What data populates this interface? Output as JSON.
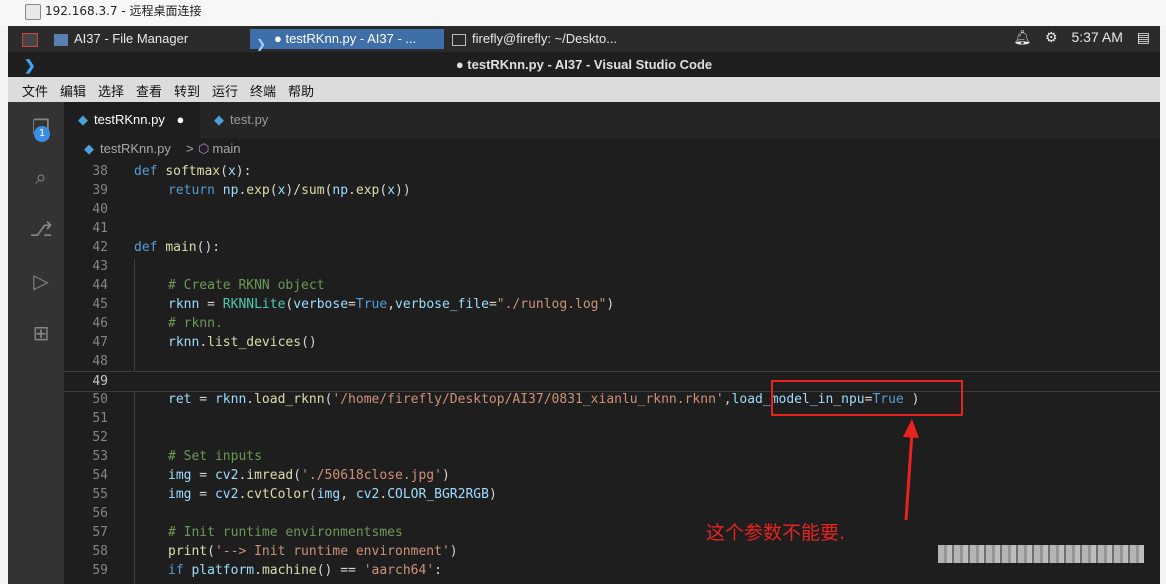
{
  "rdp": {
    "title": "192.168.3.7 - 远程桌面连接"
  },
  "taskbar": {
    "apps": [
      {
        "label": "AI37 - File Manager"
      },
      {
        "label": "● testRKnn.py - AI37 - ..."
      },
      {
        "label": "firefly@firefly: ~/Deskto..."
      }
    ],
    "time": "5:37 AM",
    "tray_icons": [
      "bell-icon",
      "gear-icon",
      "clipboard-icon"
    ]
  },
  "window": {
    "title": "● testRKnn.py - AI37 - Visual Studio Code"
  },
  "menu": [
    "文件",
    "编辑",
    "选择",
    "查看",
    "转到",
    "运行",
    "终端",
    "帮助"
  ],
  "activity": {
    "badge": "1",
    "icons": [
      "explorer-icon",
      "search-icon",
      "source-control-icon",
      "run-debug-icon",
      "extensions-icon"
    ]
  },
  "tabs": [
    {
      "label": "testRKnn.py",
      "modified": "●"
    },
    {
      "label": "test.py"
    }
  ],
  "breadcrumb": {
    "file": "testRKnn.py",
    "sep": ">",
    "symbol": "main"
  },
  "lines": [
    {
      "n": "38",
      "indent": 0,
      "tokens": [
        [
          "kw",
          "def "
        ],
        [
          "fn",
          "softmax"
        ],
        [
          "pn",
          "("
        ],
        [
          "var",
          "x"
        ],
        [
          "pn",
          "):"
        ]
      ]
    },
    {
      "n": "39",
      "indent": 1,
      "tokens": [
        [
          "kw",
          "return "
        ],
        [
          "var",
          "np"
        ],
        [
          "pn",
          "."
        ],
        [
          "fn",
          "exp"
        ],
        [
          "pn",
          "("
        ],
        [
          "var",
          "x"
        ],
        [
          "pn",
          ")/"
        ],
        [
          "fn",
          "sum"
        ],
        [
          "pn",
          "("
        ],
        [
          "var",
          "np"
        ],
        [
          "pn",
          "."
        ],
        [
          "fn",
          "exp"
        ],
        [
          "pn",
          "("
        ],
        [
          "var",
          "x"
        ],
        [
          "pn",
          "))"
        ]
      ]
    },
    {
      "n": "40",
      "indent": 0,
      "tokens": []
    },
    {
      "n": "41",
      "indent": 0,
      "tokens": []
    },
    {
      "n": "42",
      "indent": 0,
      "tokens": [
        [
          "kw",
          "def "
        ],
        [
          "fn",
          "main"
        ],
        [
          "pn",
          "():"
        ]
      ]
    },
    {
      "n": "43",
      "indent": 0,
      "tokens": []
    },
    {
      "n": "44",
      "indent": 1,
      "tokens": [
        [
          "cm",
          "# Create RKNN object"
        ]
      ]
    },
    {
      "n": "45",
      "indent": 1,
      "tokens": [
        [
          "var",
          "rknn"
        ],
        [
          "pn",
          " = "
        ],
        [
          "cls",
          "RKNNLite"
        ],
        [
          "pn",
          "("
        ],
        [
          "var",
          "verbose"
        ],
        [
          "pn",
          "="
        ],
        [
          "kw",
          "True"
        ],
        [
          "pn",
          ","
        ],
        [
          "var",
          "verbose_file"
        ],
        [
          "pn",
          "="
        ],
        [
          "str",
          "\"./runlog.log\""
        ],
        [
          "pn",
          ")"
        ]
      ]
    },
    {
      "n": "46",
      "indent": 1,
      "tokens": [
        [
          "cm",
          "# rknn."
        ]
      ]
    },
    {
      "n": "47",
      "indent": 1,
      "tokens": [
        [
          "var",
          "rknn"
        ],
        [
          "pn",
          "."
        ],
        [
          "fn",
          "list_devices"
        ],
        [
          "pn",
          "()"
        ]
      ]
    },
    {
      "n": "48",
      "indent": 0,
      "tokens": []
    },
    {
      "n": "49",
      "indent": 0,
      "tokens": [],
      "current": true
    },
    {
      "n": "50",
      "indent": 1,
      "tokens": [
        [
          "var",
          "ret"
        ],
        [
          "pn",
          " = "
        ],
        [
          "var",
          "rknn"
        ],
        [
          "pn",
          "."
        ],
        [
          "fn",
          "load_rknn"
        ],
        [
          "pn",
          "("
        ],
        [
          "str",
          "'/home/firefly/Desktop/AI37/0831_xianlu_rknn.rknn'"
        ],
        [
          "pn",
          ","
        ],
        [
          "var",
          "load_model_in_npu"
        ],
        [
          "pn",
          "="
        ],
        [
          "kw",
          "True"
        ],
        [
          "pn",
          " )"
        ]
      ]
    },
    {
      "n": "51",
      "indent": 0,
      "tokens": []
    },
    {
      "n": "52",
      "indent": 0,
      "tokens": []
    },
    {
      "n": "53",
      "indent": 1,
      "tokens": [
        [
          "cm",
          "# Set inputs"
        ]
      ]
    },
    {
      "n": "54",
      "indent": 1,
      "tokens": [
        [
          "var",
          "img"
        ],
        [
          "pn",
          " = "
        ],
        [
          "var",
          "cv2"
        ],
        [
          "pn",
          "."
        ],
        [
          "fn",
          "imread"
        ],
        [
          "pn",
          "("
        ],
        [
          "str",
          "'./50618close.jpg'"
        ],
        [
          "pn",
          ")"
        ]
      ]
    },
    {
      "n": "55",
      "indent": 1,
      "tokens": [
        [
          "var",
          "img"
        ],
        [
          "pn",
          " = "
        ],
        [
          "var",
          "cv2"
        ],
        [
          "pn",
          "."
        ],
        [
          "fn",
          "cvtColor"
        ],
        [
          "pn",
          "("
        ],
        [
          "var",
          "img"
        ],
        [
          "pn",
          ", "
        ],
        [
          "var",
          "cv2"
        ],
        [
          "pn",
          "."
        ],
        [
          "var",
          "COLOR_BGR2RGB"
        ],
        [
          "pn",
          ")"
        ]
      ]
    },
    {
      "n": "56",
      "indent": 0,
      "tokens": []
    },
    {
      "n": "57",
      "indent": 1,
      "tokens": [
        [
          "cm",
          "# Init runtime environmentsmes"
        ]
      ]
    },
    {
      "n": "58",
      "indent": 1,
      "tokens": [
        [
          "fn",
          "print"
        ],
        [
          "pn",
          "("
        ],
        [
          "str",
          "'--> Init runtime environment'"
        ],
        [
          "pn",
          ")"
        ]
      ]
    },
    {
      "n": "59",
      "indent": 1,
      "tokens": [
        [
          "kw",
          "if "
        ],
        [
          "var",
          "platform"
        ],
        [
          "pn",
          "."
        ],
        [
          "fn",
          "machine"
        ],
        [
          "pn",
          "() == "
        ],
        [
          "str",
          "'aarch64'"
        ],
        [
          "pn",
          ":"
        ]
      ]
    }
  ],
  "annotation": {
    "text": "这个参数不能要."
  },
  "colors": {
    "accent_red": "#e8231f",
    "editor_bg": "#1e1e1e",
    "vscode_blue": "#3ea6f2"
  }
}
